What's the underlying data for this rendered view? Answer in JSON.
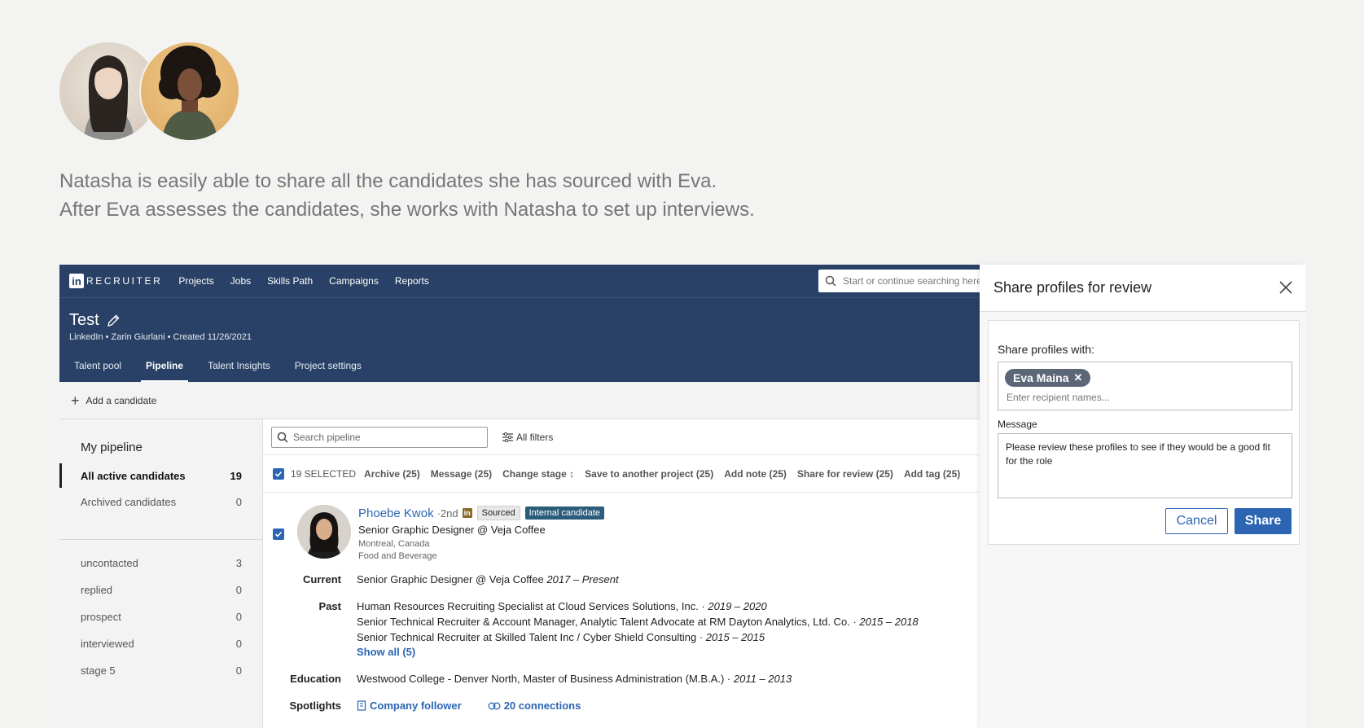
{
  "story": {
    "line1": "Natasha is easily able to share all the candidates she has sourced with Eva.",
    "line2": "After Eva assesses the candidates, she works with Natasha to set up interviews."
  },
  "navbar": {
    "brand_logo": "in",
    "brand": "RECRUITER",
    "items": [
      "Projects",
      "Jobs",
      "Skills Path",
      "Campaigns",
      "Reports"
    ],
    "search_placeholder": "Start or continue searching here"
  },
  "project": {
    "title": "Test",
    "meta": "LinkedIn • Zarin Giurlani • Created 11/26/2021",
    "tabs": [
      "Talent pool",
      "Pipeline",
      "Talent Insights",
      "Project settings"
    ],
    "active_tab": "Pipeline"
  },
  "add_candidate": "Add a candidate",
  "sidebar": {
    "title": "My pipeline",
    "rows": [
      {
        "label": "All active candidates",
        "count": "19"
      },
      {
        "label": "Archived candidates",
        "count": "0"
      },
      {
        "label": "uncontacted",
        "count": "3"
      },
      {
        "label": "replied",
        "count": "0"
      },
      {
        "label": "prospect",
        "count": "0"
      },
      {
        "label": "interviewed",
        "count": "0"
      },
      {
        "label": "stage 5",
        "count": "0"
      }
    ]
  },
  "toolbar": {
    "search_placeholder": "Search pipeline",
    "filters": "All filters"
  },
  "bulk": {
    "count": "19 SELECTED",
    "actions": [
      "Archive (25)",
      "Message (25)",
      "Change stage",
      "Save to another project (25)",
      "Add note (25)",
      "Share for review (25)",
      "Add tag (25)"
    ]
  },
  "candidate": {
    "name": "Phoebe Kwok",
    "degree": "·2nd",
    "li_badge": "in",
    "tag_sourced": "Sourced",
    "tag_internal": "Internal candidate",
    "headline": "Senior Graphic Designer @ Veja Coffee",
    "location": "Montreal, Canada",
    "industry": "Food and Beverage",
    "labels": {
      "current": "Current",
      "past": "Past",
      "education": "Education",
      "spotlights": "Spotlights"
    },
    "current": {
      "text": "Senior Graphic Designer @ Veja Coffee",
      "dates": "2017 – Present"
    },
    "past": [
      {
        "text": "Human Resources Recruiting Specialist at Cloud Services Solutions, Inc. ·",
        "dates": "2019 – 2020"
      },
      {
        "text": "Senior Technical Recruiter & Account Manager, Analytic Talent Advocate at RM Dayton Analytics, Ltd. Co. ·",
        "dates": "2015 – 2018"
      },
      {
        "text": "Senior Technical Recruiter at Skilled Talent Inc / Cyber Shield Consulting ·",
        "dates": "2015 – 2015"
      }
    ],
    "show_all": "Show all (5)",
    "education": {
      "text": "Westwood College - Denver North, Master of Business Administration (M.B.A.) ·",
      "dates": "2011 – 2013"
    },
    "spotlights": [
      "Company follower",
      "20 connections"
    ]
  },
  "modal": {
    "title": "Share profiles for review",
    "share_with_label": "Share profiles with:",
    "recipient": "Eva Maina",
    "recipient_remove": "✕",
    "recipient_placeholder": "Enter recipient names...",
    "message_label": "Message",
    "message": "Please review these profiles to see if they would be a good fit for the role",
    "cancel": "Cancel",
    "share": "Share"
  },
  "colors": {
    "nav_bg": "#294166",
    "link": "#2b65b3",
    "internal_tag": "#2b5d7a"
  }
}
